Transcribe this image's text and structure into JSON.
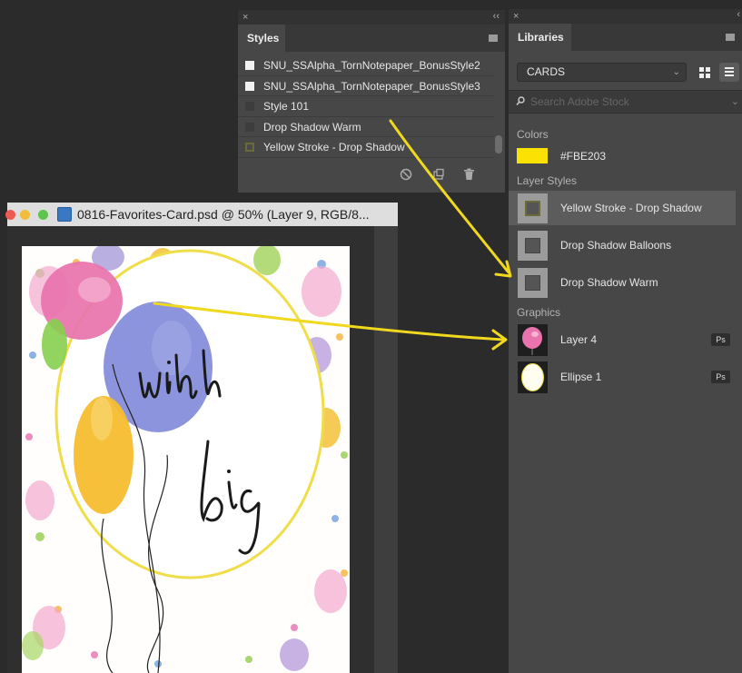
{
  "styles_panel": {
    "close_label": "×",
    "collapse_label": "‹‹",
    "tab": "Styles",
    "items": [
      {
        "label": "SNU_SSAlpha_TornNotepaper_BonusStyle2",
        "swatch": "white"
      },
      {
        "label": "SNU_SSAlpha_TornNotepaper_BonusStyle3",
        "swatch": "white"
      },
      {
        "label": "Style 101",
        "swatch": "dark"
      },
      {
        "label": "Drop Shadow Warm",
        "swatch": "dark"
      },
      {
        "label": "Yellow Stroke - Drop Shadow",
        "swatch": "stroke"
      }
    ]
  },
  "document": {
    "title": "0816-Favorites-Card.psd @ 50% (Layer 9, RGB/8..."
  },
  "libraries_panel": {
    "close_label": "×",
    "tab": "Libraries",
    "library_select": "CARDS",
    "search_placeholder": "Search Adobe Stock",
    "colors_heading": "Colors",
    "colors": [
      {
        "hex": "#FBE203",
        "label": "#FBE203"
      }
    ],
    "layer_styles_heading": "Layer Styles",
    "layer_styles": [
      {
        "label": "Yellow Stroke - Drop Shadow",
        "selected": true
      },
      {
        "label": "Drop Shadow Balloons",
        "selected": false
      },
      {
        "label": "Drop Shadow Warm",
        "selected": false
      }
    ],
    "graphics_heading": "Graphics",
    "graphics": [
      {
        "label": "Layer 4",
        "badge": "Ps",
        "icon": "pink-balloon-thumbnail"
      },
      {
        "label": "Ellipse 1",
        "badge": "Ps",
        "icon": "white-ellipse-thumbnail"
      }
    ]
  },
  "colors": {
    "annotation_arrow": "#f0d81e",
    "panel_bg": "#474747",
    "swatch": "#FBE203"
  }
}
